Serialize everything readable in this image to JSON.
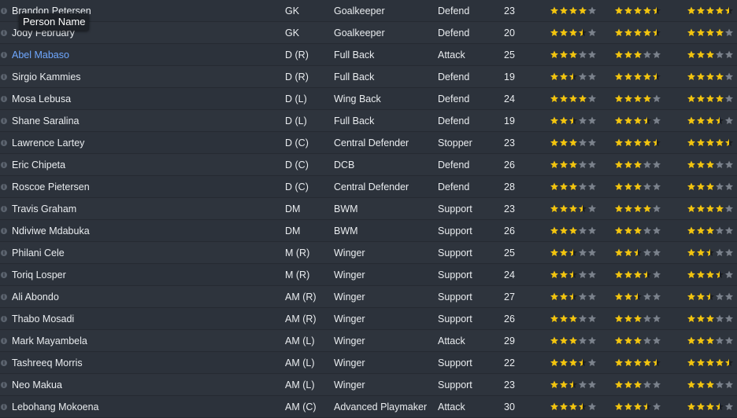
{
  "tooltip": "Person Name",
  "players": [
    {
      "name": "Brandon Petersen",
      "pos": "GK",
      "role": "Goalkeeper",
      "duty": "Defend",
      "age": "23",
      "r1": 4,
      "r2": 4.5,
      "r3": 4.5
    },
    {
      "name": "Jody February",
      "pos": "GK",
      "role": "Goalkeeper",
      "duty": "Defend",
      "age": "20",
      "r1": 3.5,
      "r2": 4.5,
      "r3": 4
    },
    {
      "name": "Abel Mabaso",
      "pos": "D (R)",
      "role": "Full Back",
      "duty": "Attack",
      "age": "25",
      "r1": 3,
      "r2": 3,
      "r3": 3,
      "link": true
    },
    {
      "name": "Sirgio Kammies",
      "pos": "D (R)",
      "role": "Full Back",
      "duty": "Defend",
      "age": "19",
      "r1": 2.5,
      "r2": 4.5,
      "r3": 4
    },
    {
      "name": "Mosa Lebusa",
      "pos": "D (L)",
      "role": "Wing Back",
      "duty": "Defend",
      "age": "24",
      "r1": 4,
      "r2": 4,
      "r3": 4
    },
    {
      "name": "Shane Saralina",
      "pos": "D (L)",
      "role": "Full Back",
      "duty": "Defend",
      "age": "19",
      "r1": 2.5,
      "r2": 3.5,
      "r3": 3.5
    },
    {
      "name": "Lawrence Lartey",
      "pos": "D (C)",
      "role": "Central Defender",
      "duty": "Stopper",
      "age": "23",
      "r1": 3,
      "r2": 4.5,
      "r3": 4.5
    },
    {
      "name": "Eric Chipeta",
      "pos": "D (C)",
      "role": "DCB",
      "duty": "Defend",
      "age": "26",
      "r1": 3,
      "r2": 3,
      "r3": 3
    },
    {
      "name": "Roscoe Pietersen",
      "pos": "D (C)",
      "role": "Central Defender",
      "duty": "Defend",
      "age": "28",
      "r1": 3,
      "r2": 3,
      "r3": 3
    },
    {
      "name": "Travis Graham",
      "pos": "DM",
      "role": "BWM",
      "duty": "Support",
      "age": "23",
      "r1": 3.5,
      "r2": 4,
      "r3": 4
    },
    {
      "name": "Ndiviwe Mdabuka",
      "pos": "DM",
      "role": "BWM",
      "duty": "Support",
      "age": "26",
      "r1": 3,
      "r2": 3,
      "r3": 3
    },
    {
      "name": "Philani Cele",
      "pos": "M (R)",
      "role": "Winger",
      "duty": "Support",
      "age": "25",
      "r1": 2.5,
      "r2": 2.5,
      "r3": 2.5
    },
    {
      "name": "Toriq Losper",
      "pos": "M (R)",
      "role": "Winger",
      "duty": "Support",
      "age": "24",
      "r1": 2.5,
      "r2": 3.5,
      "r3": 3.5
    },
    {
      "name": "Ali Abondo",
      "pos": "AM (R)",
      "role": "Winger",
      "duty": "Support",
      "age": "27",
      "r1": 2.5,
      "r2": 2.5,
      "r3": 2.5
    },
    {
      "name": "Thabo Mosadi",
      "pos": "AM (R)",
      "role": "Winger",
      "duty": "Support",
      "age": "26",
      "r1": 3,
      "r2": 3,
      "r3": 3
    },
    {
      "name": "Mark Mayambela",
      "pos": "AM (L)",
      "role": "Winger",
      "duty": "Attack",
      "age": "29",
      "r1": 3,
      "r2": 3,
      "r3": 3
    },
    {
      "name": "Tashreeq Morris",
      "pos": "AM (L)",
      "role": "Winger",
      "duty": "Support",
      "age": "22",
      "r1": 3.5,
      "r2": 4.5,
      "r3": 4.5
    },
    {
      "name": "Neo Makua",
      "pos": "AM (L)",
      "role": "Winger",
      "duty": "Support",
      "age": "23",
      "r1": 2.5,
      "r2": 3,
      "r3": 3
    },
    {
      "name": "Lebohang Mokoena",
      "pos": "AM (C)",
      "role": "Advanced Playmaker",
      "duty": "Attack",
      "age": "30",
      "r1": 3.5,
      "r2": 3.5,
      "r3": 3.5
    }
  ],
  "colors": {
    "star_full": "#f2c40f",
    "star_empty": "#7a818b",
    "star_dark": "#1b1e22"
  }
}
